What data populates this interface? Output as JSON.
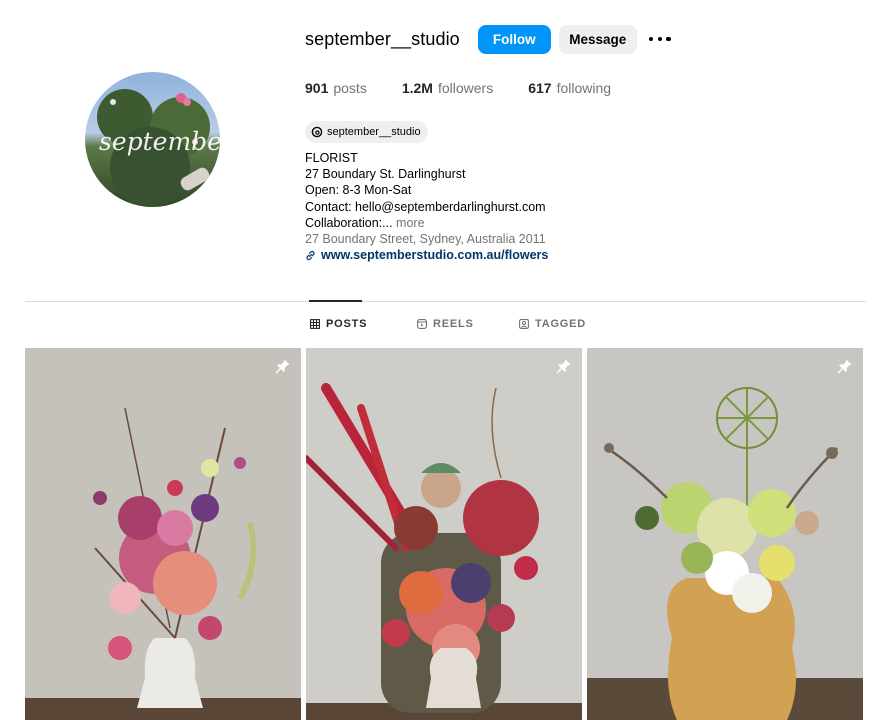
{
  "profile": {
    "username": "september__studio",
    "avatar_text": "september"
  },
  "actions": {
    "follow_label": "Follow",
    "message_label": "Message",
    "more_icon": "more-horizontal-icon"
  },
  "stats": {
    "posts_count": "901",
    "posts_label": "posts",
    "followers_count": "1.2M",
    "followers_label": "followers",
    "following_count": "617",
    "following_label": "following"
  },
  "threads": {
    "handle": "september__studio",
    "icon": "threads-icon"
  },
  "bio": {
    "line1": "FLORIST",
    "line2": "27 Boundary St. Darlinghurst",
    "line3": "Open: 8-3 Mon-Sat",
    "line4": "Contact: hello@septemberdarlinghurst.com",
    "line5": "Collaboration:...",
    "more": "more",
    "location": "27 Boundary Street, Sydney, Australia 2011",
    "link": "www.septemberstudio.com.au/flowers",
    "link_icon": "link-icon"
  },
  "tabs": [
    {
      "label": "POSTS",
      "icon": "grid-icon",
      "active": true
    },
    {
      "label": "REELS",
      "icon": "reels-icon",
      "active": false
    },
    {
      "label": "TAGGED",
      "icon": "tagged-icon",
      "active": false
    }
  ],
  "posts": [
    {
      "pinned": true,
      "icon": "pin-icon"
    },
    {
      "pinned": true,
      "icon": "pin-icon"
    },
    {
      "pinned": true,
      "icon": "pin-icon"
    }
  ],
  "colors": {
    "follow_button": "#0095f6",
    "secondary_button": "#efefef",
    "link": "#00376b",
    "muted_text": "#737373",
    "divider": "#dbdbdb"
  }
}
